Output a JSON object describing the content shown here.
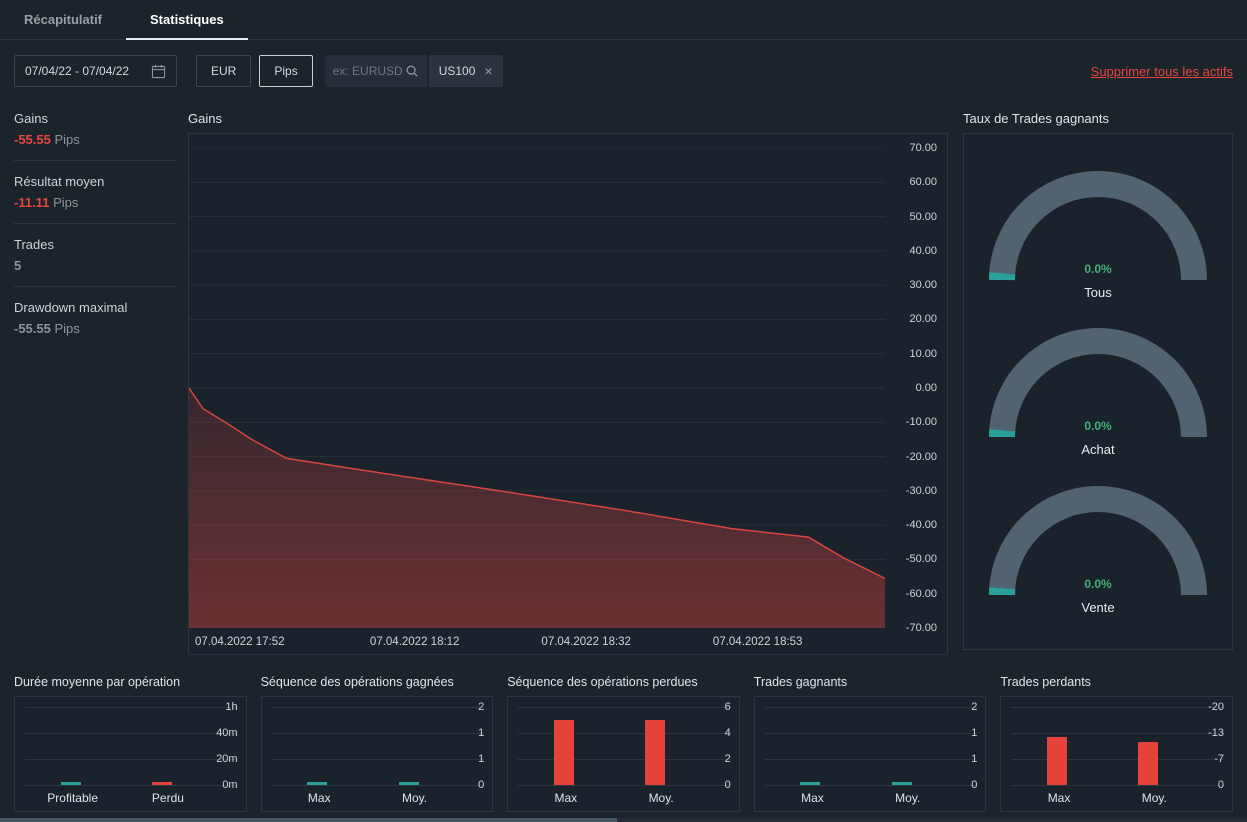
{
  "tabs": {
    "recap": "Récapitulatif",
    "stats": "Statistiques"
  },
  "filters": {
    "date_range": "07/04/22 - 07/04/22",
    "currency": "EUR",
    "unit": "Pips",
    "search_placeholder": "ex: EURUSD",
    "asset_chip": "US100",
    "chip_close": "×",
    "remove_all": "Supprimer tous les actifs"
  },
  "summary": {
    "items": [
      {
        "label": "Gains",
        "value": "-55.55",
        "unit": "Pips",
        "color": "#e8463d"
      },
      {
        "label": "Résultat moyen",
        "value": "-11.11",
        "unit": "Pips",
        "color": "#e8463d"
      },
      {
        "label": "Trades",
        "value": "5",
        "unit": "",
        "color": "#8b949c"
      },
      {
        "label": "Drawdown maximal",
        "value": "-55.55",
        "unit": "Pips",
        "color": "#8b949c"
      }
    ]
  },
  "gains_chart": {
    "type": "area",
    "title": "Gains",
    "ylim": [
      -70,
      70
    ],
    "yticks": [
      "70.00",
      "60.00",
      "50.00",
      "40.00",
      "30.00",
      "20.00",
      "10.00",
      "0.00",
      "-10.00",
      "-20.00",
      "-30.00",
      "-40.00",
      "-50.00",
      "-60.00",
      "-70.00"
    ],
    "x_labels": [
      "07.04.2022 17:52",
      "07.04.2022 18:12",
      "07.04.2022 18:32",
      "07.04.2022 18:53"
    ],
    "points": [
      [
        0,
        0
      ],
      [
        0.02,
        -6
      ],
      [
        0.06,
        -11
      ],
      [
        0.09,
        -15
      ],
      [
        0.14,
        -20.5
      ],
      [
        0.25,
        -24
      ],
      [
        0.43,
        -29.5
      ],
      [
        0.62,
        -35.5
      ],
      [
        0.78,
        -41
      ],
      [
        0.89,
        -43.5
      ],
      [
        0.94,
        -49.5
      ],
      [
        1,
        -55.55
      ]
    ],
    "line_color": "#d8453f",
    "grid_color": "#27313a"
  },
  "win_rate": {
    "title": "Taux de Trades gagnants",
    "gauge_color": "#50636f",
    "value_color": "#2aa198",
    "gauges": [
      {
        "value": "0.0%",
        "label": "Tous"
      },
      {
        "value": "0.0%",
        "label": "Achat"
      },
      {
        "value": "0.0%",
        "label": "Vente"
      }
    ]
  },
  "mini_charts": [
    {
      "type": "bar",
      "title": "Durée moyenne par opération",
      "categories": [
        "Profitable",
        "Perdu"
      ],
      "values": [
        2,
        2
      ],
      "ymax": 60,
      "yticks": [
        "1h",
        "40m",
        "20m",
        "0m"
      ],
      "colors": [
        "#2aa198",
        "#e5423c"
      ]
    },
    {
      "type": "bar",
      "title": "Séquence des opérations gagnées",
      "categories": [
        "Max",
        "Moy."
      ],
      "values": [
        0,
        0
      ],
      "ymax": 2,
      "yticks": [
        "2",
        "1",
        "1",
        "0"
      ],
      "colors": [
        "#2aa198",
        "#2aa198"
      ]
    },
    {
      "type": "bar",
      "title": "Séquence des opérations perdues",
      "categories": [
        "Max",
        "Moy."
      ],
      "values": [
        5,
        5
      ],
      "ymax": 6,
      "yticks": [
        "6",
        "4",
        "2",
        "0"
      ],
      "colors": [
        "#e5423c",
        "#e5423c"
      ]
    },
    {
      "type": "bar",
      "title": "Trades gagnants",
      "categories": [
        "Max",
        "Moy."
      ],
      "values": [
        0,
        0
      ],
      "ymax": 2,
      "yticks": [
        "2",
        "1",
        "1",
        "0"
      ],
      "colors": [
        "#2aa198",
        "#2aa198"
      ]
    },
    {
      "type": "bar",
      "title": "Trades perdants",
      "categories": [
        "Max",
        "Moy."
      ],
      "values": [
        -12.33,
        -11.11
      ],
      "ymax": 20,
      "yticks": [
        "-20",
        "-13",
        "-7",
        "0"
      ],
      "colors": [
        "#e5423c",
        "#e5423c"
      ]
    }
  ]
}
